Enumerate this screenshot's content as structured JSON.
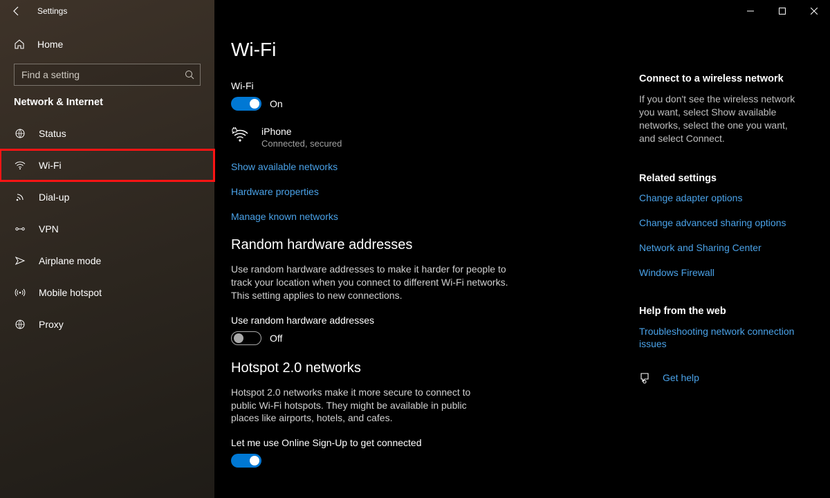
{
  "titlebar": {
    "title": "Settings"
  },
  "sidebar": {
    "home": "Home",
    "search_placeholder": "Find a setting",
    "group": "Network & Internet",
    "items": [
      {
        "label": "Status"
      },
      {
        "label": "Wi-Fi"
      },
      {
        "label": "Dial-up"
      },
      {
        "label": "VPN"
      },
      {
        "label": "Airplane mode"
      },
      {
        "label": "Mobile hotspot"
      },
      {
        "label": "Proxy"
      }
    ]
  },
  "main": {
    "page_title": "Wi-Fi",
    "wifi_label": "Wi-Fi",
    "wifi_state": "On",
    "network": {
      "name": "iPhone",
      "status": "Connected, secured"
    },
    "links": {
      "show_networks": "Show available networks",
      "hw_props": "Hardware properties",
      "manage_known": "Manage known networks"
    },
    "section_random": {
      "title": "Random hardware addresses",
      "desc": "Use random hardware addresses to make it harder for people to track your location when you connect to different Wi-Fi networks. This setting applies to new connections.",
      "toggle_label": "Use random hardware addresses",
      "toggle_state": "Off"
    },
    "section_hotspot": {
      "title": "Hotspot 2.0 networks",
      "desc": "Hotspot 2.0 networks make it more secure to connect to public Wi-Fi hotspots. They might be available in public places like airports, hotels, and cafes.",
      "toggle_label": "Let me use Online Sign-Up to get connected"
    }
  },
  "aside": {
    "connect_head": "Connect to a wireless network",
    "connect_text": "If you don't see the wireless network you want, select Show available networks, select the one you want, and select Connect.",
    "related_head": "Related settings",
    "related_links": {
      "adapter": "Change adapter options",
      "sharing": "Change advanced sharing options",
      "center": "Network and Sharing Center",
      "firewall": "Windows Firewall"
    },
    "help_head": "Help from the web",
    "help_link": "Troubleshooting network connection issues",
    "get_help": "Get help"
  }
}
